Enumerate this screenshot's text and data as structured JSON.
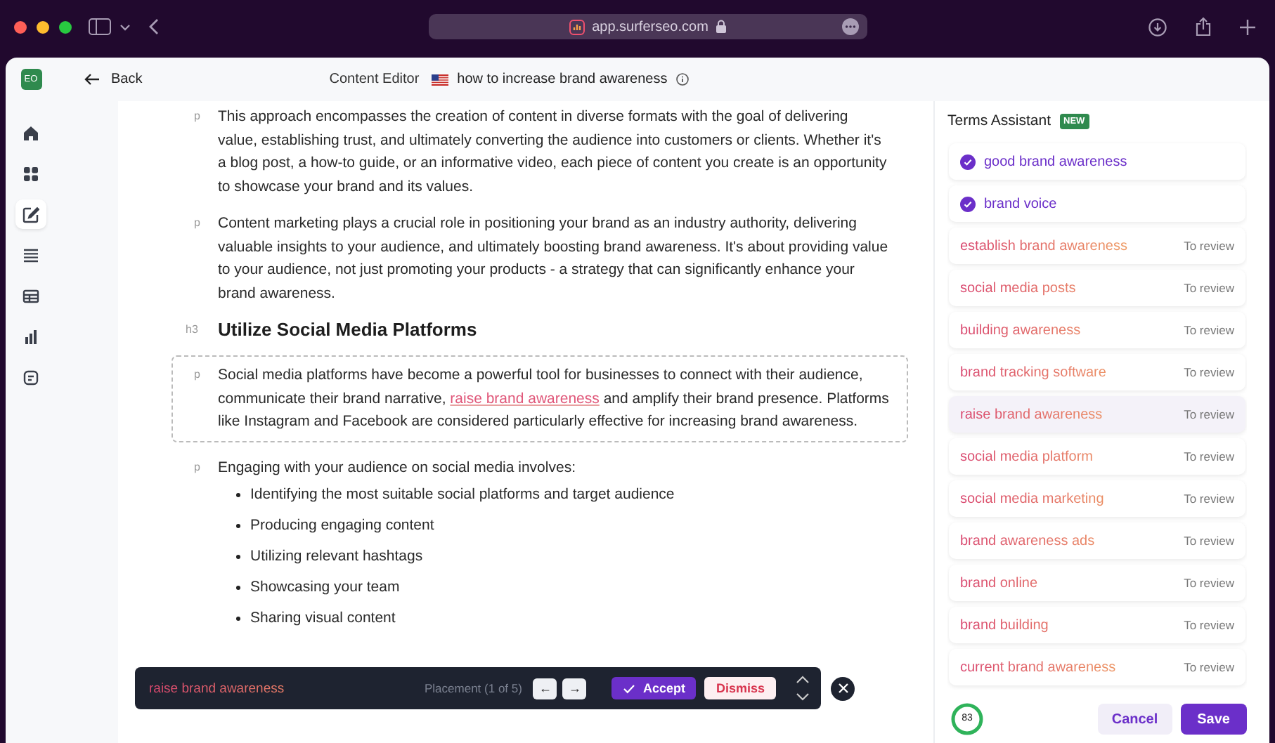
{
  "browser": {
    "address": "app.surferseo.com"
  },
  "app": {
    "avatar": "EO",
    "back": "Back",
    "section": "Content Editor",
    "document_title": "how to increase brand awareness"
  },
  "sidebar": {
    "items": [
      {
        "selected": false
      },
      {
        "selected": false
      },
      {
        "selected": true
      },
      {
        "selected": false
      },
      {
        "selected": false
      },
      {
        "selected": false
      },
      {
        "selected": false
      }
    ]
  },
  "editor": {
    "blocks": [
      {
        "kind": "paragraph",
        "tag": "p",
        "text": "This approach encompasses the creation of content in diverse formats with the goal of delivering value, establishing trust, and ultimately converting the audience into customers or clients. Whether it's a blog post, a how-to guide, or an informative video, each piece of content you create is an opportunity to showcase your brand and its values."
      },
      {
        "kind": "paragraph",
        "tag": "p",
        "text": "Content marketing plays a crucial role in positioning your brand as an industry authority, delivering valuable insights to your audience, and ultimately boosting brand awareness. It's about providing value to your audience, not just promoting your products - a strategy that can significantly enhance your brand awareness."
      },
      {
        "kind": "heading",
        "tag": "h3",
        "text": "Utilize Social Media Platforms"
      },
      {
        "kind": "focused",
        "tag": "p",
        "before": "Social media platforms have become a powerful tool for businesses to connect with their audience, communicate their brand narrative,",
        "term": "raise brand awareness",
        "after": "and amplify their brand presence. Platforms like Instagram and Facebook are considered particularly effective for increasing brand awareness."
      },
      {
        "kind": "list",
        "tag": "p",
        "text": "Engaging with your audience on social media involves:",
        "items": [
          "Identifying the most suitable social platforms and target audience",
          "Producing engaging content",
          "Utilizing relevant hashtags",
          "Showcasing your team",
          "Sharing visual content"
        ]
      }
    ]
  },
  "placement_bar": {
    "term": "raise brand awareness",
    "placement": "Placement (1 of 5)",
    "prev": "←",
    "next": "→",
    "accept": "Accept",
    "dismiss": "Dismiss"
  },
  "terms_assistant": {
    "title": "Terms Assistant",
    "badge": "NEW",
    "terms": [
      {
        "name": "good brand awareness",
        "kind": "used",
        "selected": false
      },
      {
        "name": "brand voice",
        "kind": "used",
        "selected": false
      },
      {
        "name": "establish brand awareness",
        "kind": "review",
        "status": "To review",
        "selected": false
      },
      {
        "name": "social media posts",
        "kind": "review",
        "status": "To review",
        "selected": false
      },
      {
        "name": "building awareness",
        "kind": "review",
        "status": "To review",
        "selected": false
      },
      {
        "name": "brand tracking software",
        "kind": "review",
        "status": "To review",
        "selected": false
      },
      {
        "name": "raise brand awareness",
        "kind": "review",
        "status": "To review",
        "selected": true
      },
      {
        "name": "social media platform",
        "kind": "review",
        "status": "To review",
        "selected": false
      },
      {
        "name": "social media marketing",
        "kind": "review",
        "status": "To review",
        "selected": false
      },
      {
        "name": "brand awareness ads",
        "kind": "review",
        "status": "To review",
        "selected": false
      },
      {
        "name": "brand online",
        "kind": "review",
        "status": "To review",
        "selected": false
      },
      {
        "name": "brand building",
        "kind": "review",
        "status": "To review",
        "selected": false
      },
      {
        "name": "current brand awareness",
        "kind": "review",
        "status": "To review",
        "selected": false
      }
    ],
    "score": {
      "value": "83"
    },
    "cancel": "Cancel",
    "save": "Save"
  }
}
